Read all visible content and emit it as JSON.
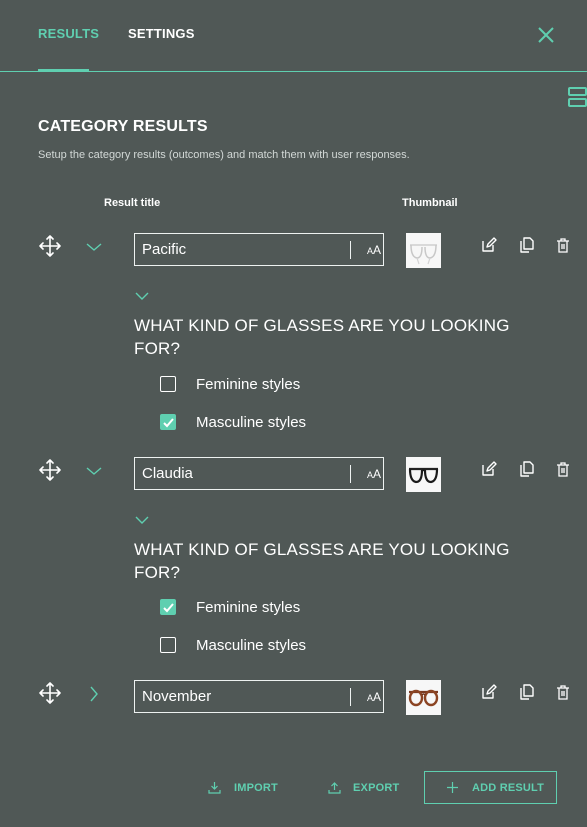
{
  "tabs": {
    "results": "RESULTS",
    "settings": "SETTINGS"
  },
  "section": {
    "title": "CATEGORY RESULTS",
    "description": "Setup the category results (outcomes) and match them with user responses."
  },
  "columns": {
    "result_title": "Result title",
    "thumbnail": "Thumbnail"
  },
  "aa_label": {
    "small": "A",
    "large": "A"
  },
  "results": [
    {
      "title": "Pacific",
      "expanded": true,
      "thumbnail": "clear-frame-glasses",
      "question": "WHAT KIND OF GLASSES ARE YOU LOOKING FOR?",
      "options": [
        {
          "label": "Feminine styles",
          "checked": false
        },
        {
          "label": "Masculine styles",
          "checked": true
        }
      ]
    },
    {
      "title": "Claudia",
      "expanded": true,
      "thumbnail": "black-frame-glasses",
      "question": "WHAT KIND OF GLASSES ARE YOU LOOKING FOR?",
      "options": [
        {
          "label": "Feminine styles",
          "checked": true
        },
        {
          "label": "Masculine styles",
          "checked": false
        }
      ]
    },
    {
      "title": "November",
      "expanded": false,
      "thumbnail": "tortoise-frame-glasses"
    }
  ],
  "footer": {
    "import": "IMPORT",
    "export": "EXPORT",
    "add_result": "ADD RESULT"
  },
  "colors": {
    "background": "#505856",
    "accent": "#5fcfb0",
    "text": "#ffffff"
  }
}
